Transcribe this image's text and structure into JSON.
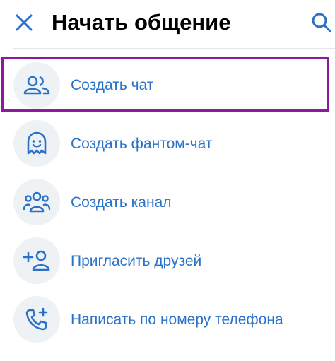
{
  "header": {
    "title": "Начать общение",
    "close_icon": "close-icon",
    "search_icon": "search-icon"
  },
  "menu": {
    "items": [
      {
        "label": "Создать чат",
        "icon": "group-chat-icon",
        "highlighted": true
      },
      {
        "label": "Создать фантом-чат",
        "icon": "ghost-icon",
        "highlighted": false
      },
      {
        "label": "Создать канал",
        "icon": "channel-users-icon",
        "highlighted": false
      },
      {
        "label": "Пригласить друзей",
        "icon": "add-user-icon",
        "highlighted": false
      },
      {
        "label": "Написать по номеру телефона",
        "icon": "phone-add-icon",
        "highlighted": false
      }
    ]
  },
  "colors": {
    "accent": "#2a72c8",
    "highlight_border": "#8b1a9c",
    "icon_bg": "#eff2f5"
  }
}
